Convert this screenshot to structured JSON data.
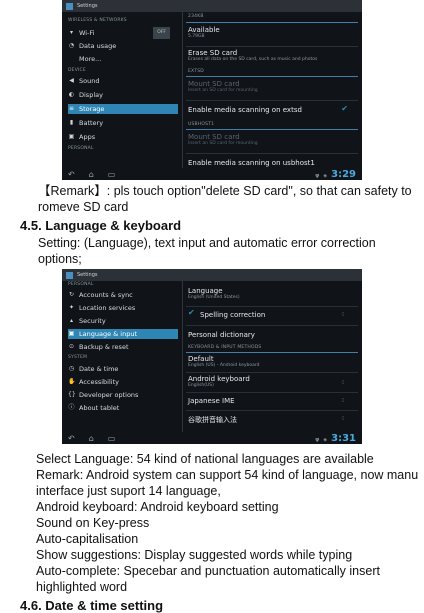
{
  "shot1": {
    "app_title": "Settings",
    "sections": [
      "WIRELESS & NETWORKS",
      "DEVICE",
      "PERSONAL"
    ],
    "items": [
      {
        "label": "Wi-Fi",
        "toggle": "OFF"
      },
      {
        "label": "Data usage"
      },
      {
        "label": "More..."
      },
      {
        "label": "Sound"
      },
      {
        "label": "Display"
      },
      {
        "label": "Storage"
      },
      {
        "label": "Battery"
      },
      {
        "label": "Apps"
      }
    ],
    "right": {
      "header_top": "234KB",
      "available_title": "Available",
      "available_sub": "5.79GB",
      "erase_title": "Erase SD card",
      "erase_sub": "Erases all data on the SD card, such as music and photos",
      "sec_extsd": "EXTSD",
      "mount_title": "Mount SD card",
      "mount_sub": "Insert an SD card for mounting",
      "enable_extsd": "Enable media scanning on extsd",
      "sec_usbhost": "USBHOST1",
      "mount2_title": "Mount SD card",
      "mount2_sub": "Insert an SD card for mounting",
      "enable_usbhost": "Enable media scanning on usbhost1"
    },
    "clock": "3:29"
  },
  "remark": "【Remark】: pls touch option\"delete SD card\", so that can safety to",
  "remark2": "romeve SD card",
  "heading": "4.5. Language & keyboard",
  "setting_line1": "Setting: (Language), text input and automatic error correction",
  "setting_line2": "options;",
  "shot2": {
    "app_title": "Settings",
    "sections": [
      "PERSONAL",
      "SYSTEM"
    ],
    "items": [
      {
        "label": "Accounts & sync"
      },
      {
        "label": "Location services"
      },
      {
        "label": "Security"
      },
      {
        "label": "Language & input"
      },
      {
        "label": "Backup & reset"
      },
      {
        "label": "Date & time"
      },
      {
        "label": "Accessibility"
      },
      {
        "label": "Developer options"
      },
      {
        "label": "About tablet"
      }
    ],
    "right": {
      "language_title": "Language",
      "language_sub": "English (United States)",
      "spelling": "Spelling correction",
      "personal_dict": "Personal dictionary",
      "sec_kb": "KEYBOARD & INPUT METHODS",
      "default_title": "Default",
      "default_sub": "English (US) - Android keyboard",
      "akb_title": "Android keyboard",
      "akb_sub": "English(US)",
      "jime": "Japanese IME",
      "pinyin": "谷歌拼音输入法"
    },
    "clock": "3:31"
  },
  "body_lines": [
    "Select Language: 54 kind of national languages are available",
    "Remark: Android system can support 54 kind of language, now manu",
    "interface just suport   14 language,",
    "Android keyboard: Android keyboard setting",
    "Sound on Key-press",
    "Auto-capitalisation",
    "Show suggestions: Display suggested words while typing",
    "Auto-complete: Specebar and punctuation automatically insert",
    "highlighted word"
  ],
  "bottom_heading_partial": "4.6. Date & time setting"
}
